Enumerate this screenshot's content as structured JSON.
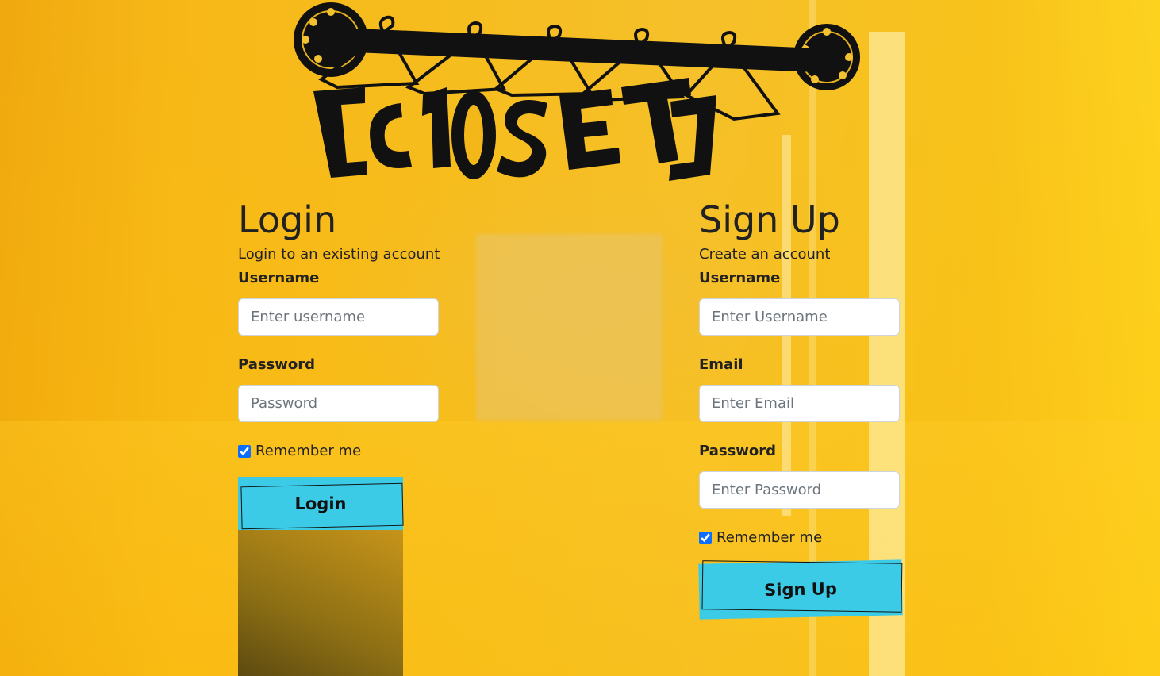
{
  "brand": {
    "logo_text": "[CLOSET]"
  },
  "login": {
    "title": "Login",
    "subtitle": "Login to an existing account",
    "username_label": "Username",
    "username_placeholder": "Enter username",
    "password_label": "Password",
    "password_placeholder": "Password",
    "remember_label": "Remember me",
    "remember_checked": true,
    "button_label": "Login"
  },
  "signup": {
    "title": "Sign Up",
    "subtitle": "Create an account",
    "username_label": "Username",
    "username_placeholder": "Enter Username",
    "email_label": "Email",
    "email_placeholder": "Enter Email",
    "password_label": "Password",
    "password_placeholder": "Enter Password",
    "remember_label": "Remember me",
    "remember_checked": true,
    "button_label": "Sign Up"
  },
  "colors": {
    "background": "#f5b91a",
    "button": "#3ccbe6",
    "text": "#222222"
  }
}
